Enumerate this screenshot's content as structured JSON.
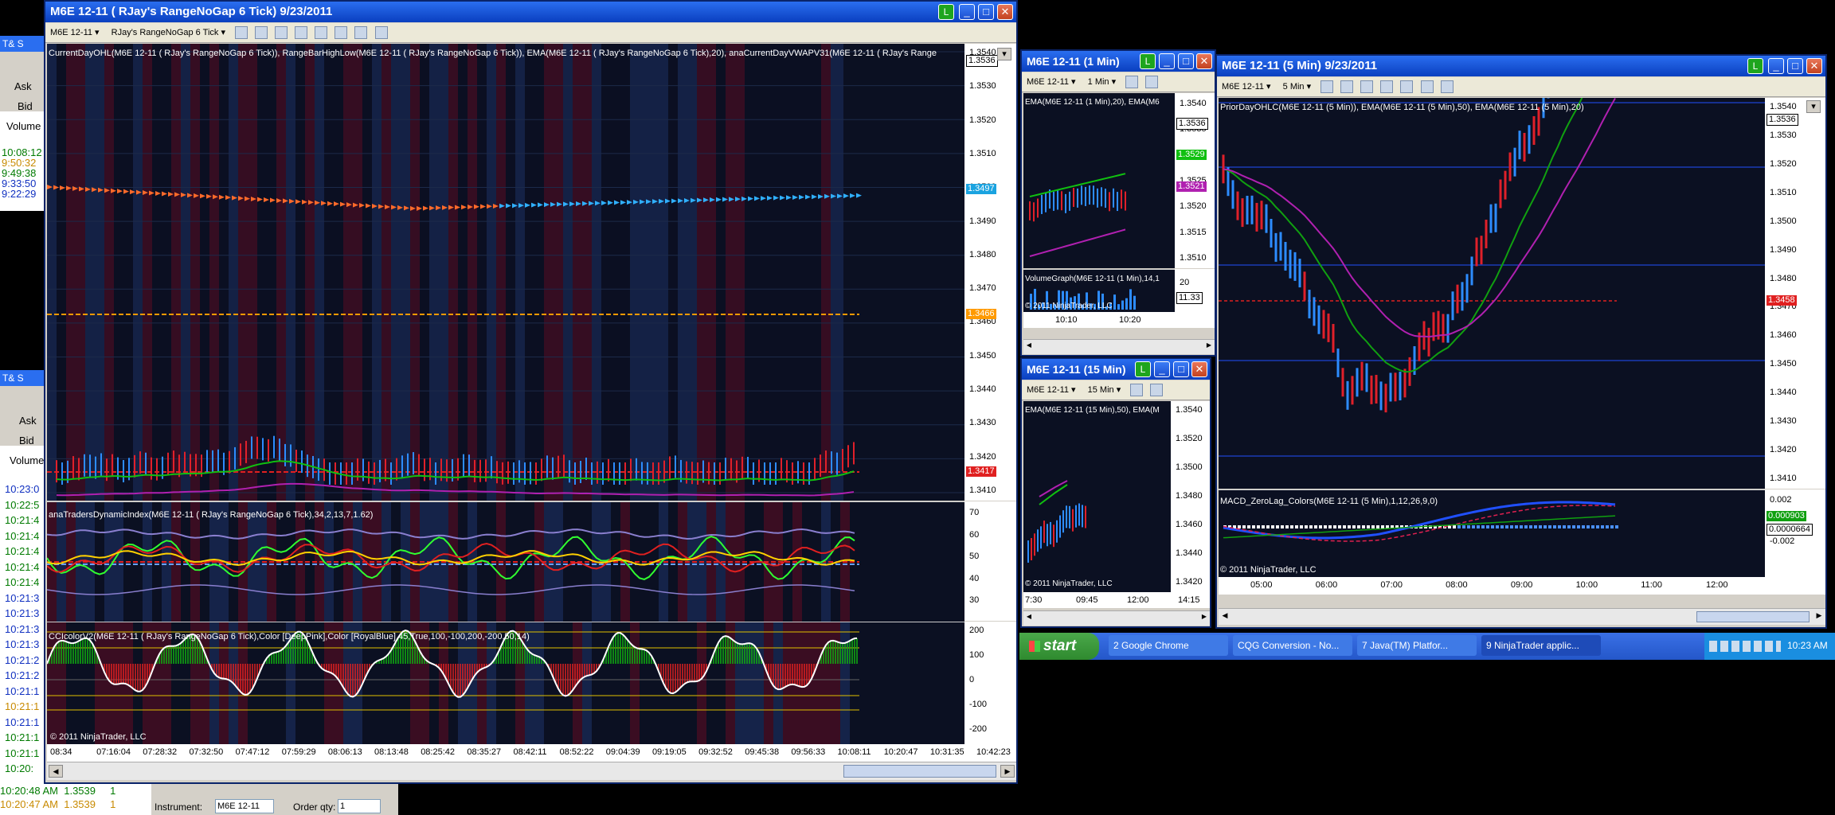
{
  "left_strip": {
    "top_title": "T& S",
    "rows": [
      "Ask",
      "Bid",
      "Volume"
    ],
    "times": [
      "10:08:12",
      "9:50:32",
      "9:49:38",
      "9:33:50",
      "9:22:29"
    ],
    "second_title": "T& S",
    "second_times": [
      "10:23:0",
      "10:22:5",
      "10:21:4",
      "10:21:4",
      "10:21:4",
      "10:21:4",
      "10:21:4",
      "10:21:3",
      "10:21:3",
      "10:21:3",
      "10:21:3",
      "10:21:2",
      "10:21:2",
      "10:21:1",
      "10:21:1",
      "10:21:1",
      "10:21:1",
      "10:21:1",
      "10:20:"
    ],
    "bottom_rows": [
      {
        "time": "10:20:48 AM",
        "price": "1.3539",
        "qty": "1"
      },
      {
        "time": "10:20:47 AM",
        "price": "1.3539",
        "qty": "1"
      }
    ],
    "instrument_label": "Instrument:",
    "instrument_value": "M6E 12-11",
    "orderqty_label": "Order qty:",
    "orderqty_value": "1"
  },
  "main_window": {
    "title": "M6E 12-11 ( RJay's RangeNoGap  6 Tick)  9/23/2011",
    "toolbar": {
      "instrument": "M6E 12-11",
      "period": "RJay's RangeNoGap  6 Tick"
    },
    "indicator_label": "CurrentDayOHL(M6E 12-11 ( RJay's RangeNoGap  6 Tick)), RangeBarHighLow(M6E 12-11 ( RJay's RangeNoGap  6 Tick)), EMA(M6E 12-11 ( RJay's RangeNoGap  6 Tick),20), anaCurrentDayVWAPV31(M6E 12-11 ( RJay's Range",
    "price_axis": [
      "1.3540",
      "1.3530",
      "1.3520",
      "1.3510",
      "1.3500",
      "1.3490",
      "1.3480",
      "1.3470",
      "1.3460",
      "1.3450",
      "1.3440",
      "1.3430",
      "1.3420",
      "1.3410"
    ],
    "tags": {
      "last": "1.3536",
      "vwap": "1.3497",
      "orange": "1.3466",
      "red": "1.3417"
    },
    "panel2_label": "anaTradersDynamicIndex(M6E 12-11 ( RJay's RangeNoGap  6 Tick),34,2,13,7,1.62)",
    "panel2_axis": [
      "70",
      "60",
      "50",
      "40",
      "30"
    ],
    "panel3_label": "CCIcolorV2(M6E 12-11 ( RJay's RangeNoGap  6 Tick),Color [DeepPink],Color [RoyalBlue],45,True,100,-100,200,-200,50,14)",
    "panel3_axis": [
      "200",
      "100",
      "0",
      "-100",
      "-200"
    ],
    "copyright": "© 2011 NinjaTrader, LLC",
    "time_axis": [
      "08:34",
      "07:16:04",
      "07:28:32",
      "07:32:50",
      "07:47:12",
      "07:59:29",
      "08:06:13",
      "08:13:48",
      "08:25:42",
      "08:35:27",
      "08:42:11",
      "08:52:22",
      "09:04:39",
      "09:19:05",
      "09:32:52",
      "09:45:38",
      "09:56:33",
      "10:08:11",
      "10:20:47",
      "10:31:35",
      "10:42:23"
    ]
  },
  "win_1min": {
    "title": "M6E 12-11 (1 Min)",
    "toolbar": {
      "instrument": "M6E 12-11",
      "period": "1 Min"
    },
    "indicator_label": "EMA(M6E 12-11 (1 Min),20), EMA(M6",
    "price_axis": [
      "1.3540",
      "1.3535",
      "1.3530",
      "1.3525",
      "1.3520",
      "1.3515",
      "1.3510"
    ],
    "tags": {
      "last": "1.3536",
      "green": "1.3529",
      "pink": "1.3521",
      "vol": "11.33"
    },
    "vol_label": "VolumeGraph(M6E 12-11 (1 Min),14,1",
    "vol_axis": [
      "20"
    ],
    "copyright": "© 2011 NinjaTrader, LLC",
    "time_axis": [
      "10:10",
      "10:20"
    ]
  },
  "win_15min": {
    "title": "M6E 12-11 (15 Min)",
    "toolbar": {
      "instrument": "M6E 12-11",
      "period": "15 Min"
    },
    "indicator_label": "EMA(M6E 12-11 (15 Min),50), EMA(M",
    "price_axis": [
      "1.3540",
      "1.3520",
      "1.3500",
      "1.3480",
      "1.3460",
      "1.3440",
      "1.3420"
    ],
    "copyright": "© 2011 NinjaTrader, LLC",
    "time_axis": [
      "7:30",
      "09:45",
      "12:00",
      "14:15"
    ]
  },
  "win_5min": {
    "title": "M6E 12-11 (5 Min)  9/23/2011",
    "toolbar": {
      "instrument": "M6E 12-11",
      "period": "5 Min"
    },
    "indicator_label": "PriorDayOHLC(M6E 12-11 (5 Min)), EMA(M6E 12-11 (5 Min),50), EMA(M6E 12-11 (5 Min),20)",
    "price_axis": [
      "1.3540",
      "1.3530",
      "1.3520",
      "1.3510",
      "1.3500",
      "1.3490",
      "1.3480",
      "1.3470",
      "1.3460",
      "1.3450",
      "1.3440",
      "1.3430",
      "1.3420",
      "1.3410"
    ],
    "tags": {
      "last": "1.3536",
      "red": "1.3458"
    },
    "panel2_label": "MACD_ZeroLag_Colors(M6E 12-11 (5 Min),1,12,26,9,0)",
    "panel2_axis": [
      "0.002",
      "-0.002"
    ],
    "panel2_tags": {
      "green": "0.000903",
      "white": "0.0000664"
    },
    "copyright": "© 2011 NinjaTrader, LLC",
    "time_axis": [
      "05:00",
      "06:00",
      "07:00",
      "08:00",
      "09:00",
      "10:00",
      "11:00",
      "12:00"
    ]
  },
  "taskbar": {
    "start": "start",
    "buttons": [
      "2 Google Chrome",
      "CQG Conversion - No...",
      "7 Java(TM) Platfor...",
      "9 NinjaTrader applic..."
    ],
    "clock": "10:23 AM"
  }
}
